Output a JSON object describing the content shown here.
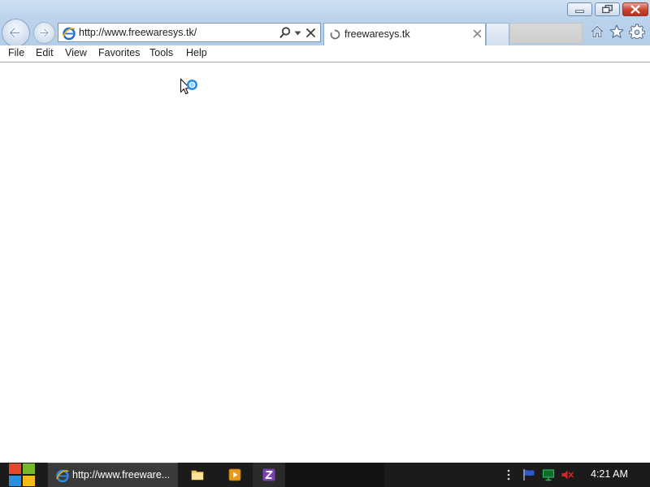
{
  "browser": {
    "address_url": "http://www.freewaresys.tk/",
    "tab_title": "freewaresys.tk"
  },
  "menu": {
    "items": [
      "File",
      "Edit",
      "View",
      "Favorites",
      "Tools",
      "Help"
    ]
  },
  "taskbar": {
    "ie_task_label": "http://www.freeware...",
    "clock": "4:21 AM"
  },
  "icons": {
    "back": "back-arrow-icon",
    "forward": "forward-arrow-icon",
    "ie": "internet-explorer-icon",
    "search": "search-icon",
    "dropdown": "chevron-down-icon",
    "stop": "close-icon",
    "tab_loading": "loading-spinner-icon",
    "home": "home-icon",
    "favorites": "star-icon",
    "tools": "gear-icon",
    "start": "windows-logo-icon",
    "explorer": "folder-icon",
    "media": "media-player-icon",
    "z_app": "z-app-icon",
    "tray_flag": "flag-icon",
    "tray_network": "network-icon",
    "tray_volume": "speaker-muted-icon"
  },
  "colors": {
    "frame": "#bcd3ec",
    "close_button": "#c7432f",
    "taskbar": "#1b1b1b",
    "ie_blue": "#1e6fd1",
    "ie_ring": "#f2b10a"
  }
}
